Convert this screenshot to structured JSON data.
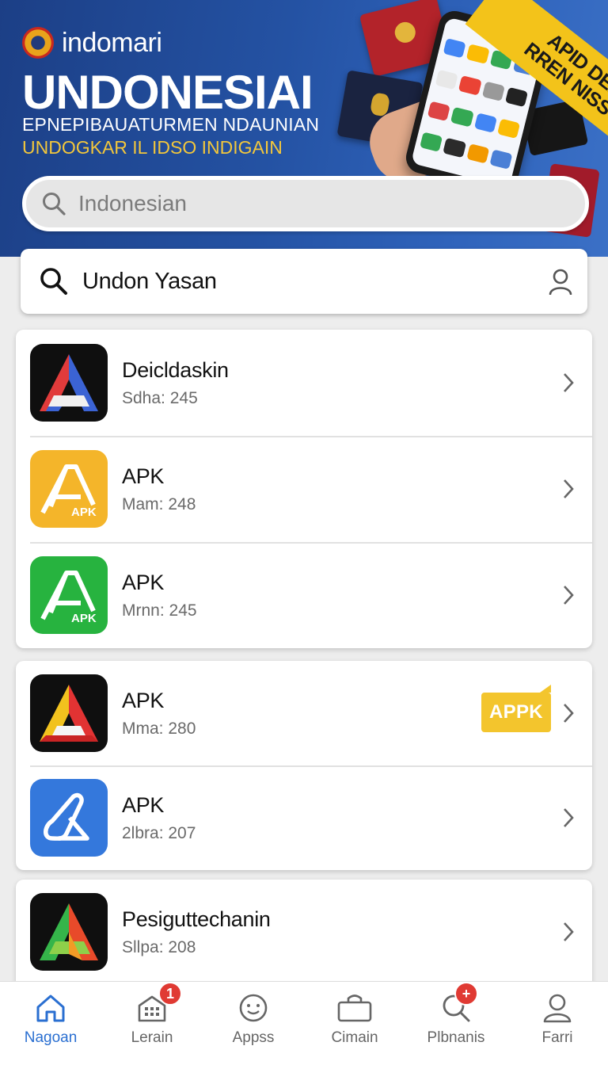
{
  "banner": {
    "brand_name": "indomari",
    "headline": "UNDONESIAI",
    "subtitle_1": "EPNEPIBAUATURMEN NDAUNIAN",
    "subtitle_2": "UNDOGKAR IL IDSO INDIGAIN",
    "ribbon_line_1": "APID DEAIR",
    "ribbon_line_2": "RREN NISSVIR",
    "search_placeholder": "Indonesian"
  },
  "search": {
    "query": "Undon Yasan"
  },
  "apps": [
    {
      "name": "Deicldaskin",
      "meta": "Sdha: 245",
      "icon": "a-logo-red-blue-icon"
    },
    {
      "name": "APK",
      "meta": "Mam: 248",
      "icon": "apk-yellow-icon",
      "icon_label": "APK"
    },
    {
      "name": "APK",
      "meta": "Mrnn: 245",
      "icon": "apk-green-icon",
      "icon_label": "APK"
    },
    {
      "name": "APK",
      "meta": "Mma: 280",
      "icon": "a-logo-yellow-red-icon",
      "badge": "APPK"
    },
    {
      "name": "APK",
      "meta": "2lbra: 207",
      "icon": "apk-blue-icon"
    },
    {
      "name": "Pesigutte​chanin",
      "meta": "Sllpa: 208",
      "icon": "a-logo-green-red-icon"
    }
  ],
  "nav": [
    {
      "label": "Nagoan",
      "icon": "home-icon",
      "active": true
    },
    {
      "label": "Lerain",
      "icon": "store-icon",
      "badge": "1"
    },
    {
      "label": "Appss",
      "icon": "apps-circle-icon"
    },
    {
      "label": "Cimain",
      "icon": "bag-icon"
    },
    {
      "label": "Plbnanis",
      "icon": "search-icon",
      "badge": "+"
    },
    {
      "label": "Farri",
      "icon": "profile-icon"
    }
  ],
  "colors": {
    "accent": "#2a6fd1",
    "banner": "#2452a3",
    "highlight": "#f3c52d",
    "notification": "#e03a33"
  }
}
